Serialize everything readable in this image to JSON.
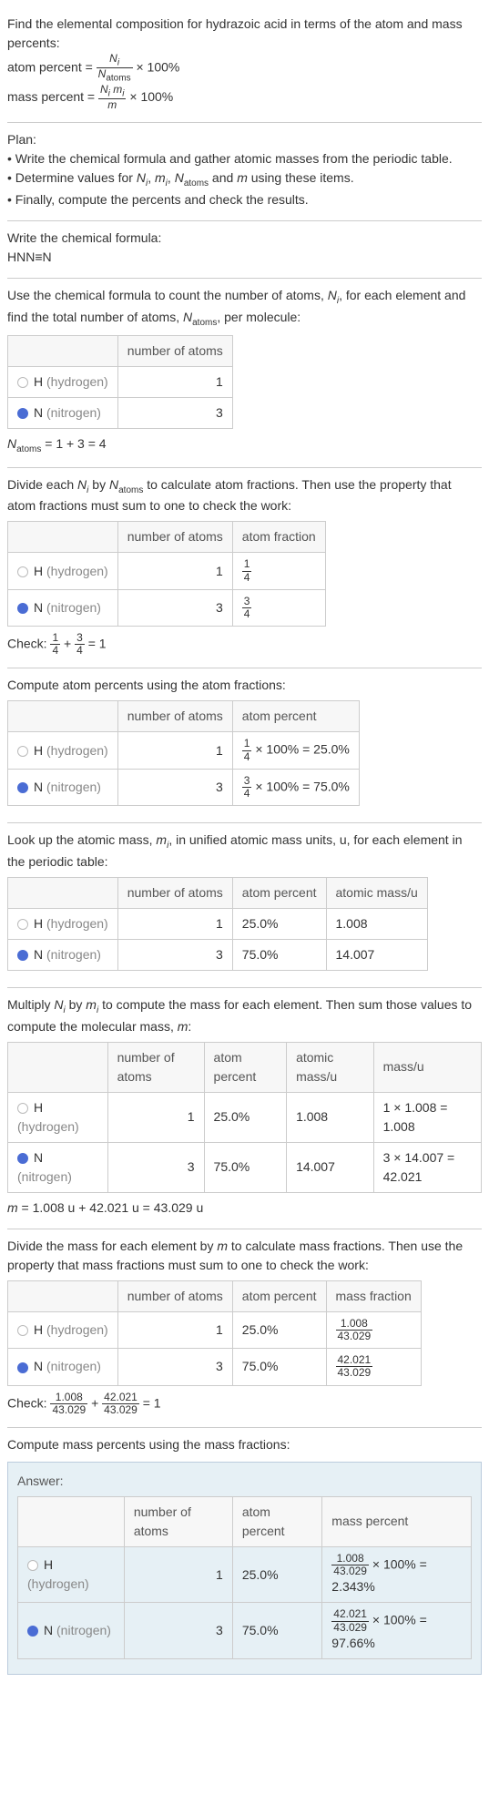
{
  "intro": {
    "line1": "Find the elemental composition for hydrazoic acid in terms of the atom and mass percents:",
    "atom_percent_label": "atom percent = ",
    "atom_percent_frac_top": "N_i",
    "atom_percent_frac_bot": "N_atoms",
    "times100": " × 100%",
    "mass_percent_label": "mass percent = ",
    "mass_percent_frac_top": "N_i m_i",
    "mass_percent_frac_bot": "m"
  },
  "plan": {
    "title": "Plan:",
    "items": [
      "Write the chemical formula and gather atomic masses from the periodic table.",
      "Determine values for N_i, m_i, N_atoms and m using these items.",
      "Finally, compute the percents and check the results."
    ]
  },
  "formula": {
    "title": "Write the chemical formula:",
    "value": "HNN≡N"
  },
  "count": {
    "title": "Use the chemical formula to count the number of atoms, N_i, for each element and find the total number of atoms, N_atoms, per molecule:",
    "headers": [
      "",
      "number of atoms"
    ],
    "rows": [
      {
        "el": "H",
        "name": "(hydrogen)",
        "n": "1"
      },
      {
        "el": "N",
        "name": "(nitrogen)",
        "n": "3"
      }
    ],
    "sum": "N_atoms = 1 + 3 = 4"
  },
  "atomfrac": {
    "title": "Divide each N_i by N_atoms to calculate atom fractions. Then use the property that atom fractions must sum to one to check the work:",
    "headers": [
      "",
      "number of atoms",
      "atom fraction"
    ],
    "rows": [
      {
        "el": "H",
        "name": "(hydrogen)",
        "n": "1",
        "frac_top": "1",
        "frac_bot": "4"
      },
      {
        "el": "N",
        "name": "(nitrogen)",
        "n": "3",
        "frac_top": "3",
        "frac_bot": "4"
      }
    ],
    "check_label": "Check: ",
    "check_a_top": "1",
    "check_a_bot": "4",
    "check_plus": " + ",
    "check_b_top": "3",
    "check_b_bot": "4",
    "check_eq": " = 1"
  },
  "atompct": {
    "title": "Compute atom percents using the atom fractions:",
    "headers": [
      "",
      "number of atoms",
      "atom percent"
    ],
    "rows": [
      {
        "el": "H",
        "name": "(hydrogen)",
        "n": "1",
        "frac_top": "1",
        "frac_bot": "4",
        "rest": " × 100% = 25.0%"
      },
      {
        "el": "N",
        "name": "(nitrogen)",
        "n": "3",
        "frac_top": "3",
        "frac_bot": "4",
        "rest": " × 100% = 75.0%"
      }
    ]
  },
  "masses": {
    "title": "Look up the atomic mass, m_i, in unified atomic mass units, u, for each element in the periodic table:",
    "headers": [
      "",
      "number of atoms",
      "atom percent",
      "atomic mass/u"
    ],
    "rows": [
      {
        "el": "H",
        "name": "(hydrogen)",
        "n": "1",
        "pct": "25.0%",
        "mass": "1.008"
      },
      {
        "el": "N",
        "name": "(nitrogen)",
        "n": "3",
        "pct": "75.0%",
        "mass": "14.007"
      }
    ]
  },
  "molmass": {
    "title": "Multiply N_i by m_i to compute the mass for each element. Then sum those values to compute the molecular mass, m:",
    "headers": [
      "",
      "number of atoms",
      "atom percent",
      "atomic mass/u",
      "mass/u"
    ],
    "rows": [
      {
        "el": "H",
        "name": "(hydrogen)",
        "n": "1",
        "pct": "25.0%",
        "mass": "1.008",
        "calc": "1 × 1.008 = 1.008"
      },
      {
        "el": "N",
        "name": "(nitrogen)",
        "n": "3",
        "pct": "75.0%",
        "mass": "14.007",
        "calc": "3 × 14.007 = 42.021"
      }
    ],
    "sum": "m = 1.008 u + 42.021 u = 43.029 u"
  },
  "massfrac": {
    "title": "Divide the mass for each element by m to calculate mass fractions. Then use the property that mass fractions must sum to one to check the work:",
    "headers": [
      "",
      "number of atoms",
      "atom percent",
      "mass fraction"
    ],
    "rows": [
      {
        "el": "H",
        "name": "(hydrogen)",
        "n": "1",
        "pct": "25.0%",
        "frac_top": "1.008",
        "frac_bot": "43.029"
      },
      {
        "el": "N",
        "name": "(nitrogen)",
        "n": "3",
        "pct": "75.0%",
        "frac_top": "42.021",
        "frac_bot": "43.029"
      }
    ],
    "check_label": "Check: ",
    "check_a_top": "1.008",
    "check_a_bot": "43.029",
    "check_plus": " + ",
    "check_b_top": "42.021",
    "check_b_bot": "43.029",
    "check_eq": " = 1"
  },
  "masspct": {
    "title": "Compute mass percents using the mass fractions:",
    "answer_label": "Answer:",
    "headers": [
      "",
      "number of atoms",
      "atom percent",
      "mass percent"
    ],
    "rows": [
      {
        "el": "H",
        "name": "(hydrogen)",
        "n": "1",
        "pct": "25.0%",
        "frac_top": "1.008",
        "frac_bot": "43.029",
        "rest": " × 100% = 2.343%"
      },
      {
        "el": "N",
        "name": "(nitrogen)",
        "n": "3",
        "pct": "75.0%",
        "frac_top": "42.021",
        "frac_bot": "43.029",
        "rest": " × 100% = 97.66%"
      }
    ]
  },
  "chart_data": {
    "type": "table",
    "title": "Elemental composition of hydrazoic acid",
    "elements": [
      {
        "symbol": "H",
        "name": "hydrogen",
        "number_of_atoms": 1,
        "atom_fraction": 0.25,
        "atom_percent": 25.0,
        "atomic_mass_u": 1.008,
        "mass_u": 1.008,
        "mass_fraction": 0.02343,
        "mass_percent": 2.343
      },
      {
        "symbol": "N",
        "name": "nitrogen",
        "number_of_atoms": 3,
        "atom_fraction": 0.75,
        "atom_percent": 75.0,
        "atomic_mass_u": 14.007,
        "mass_u": 42.021,
        "mass_fraction": 0.97657,
        "mass_percent": 97.66
      }
    ],
    "N_atoms": 4,
    "molecular_mass_u": 43.029
  }
}
